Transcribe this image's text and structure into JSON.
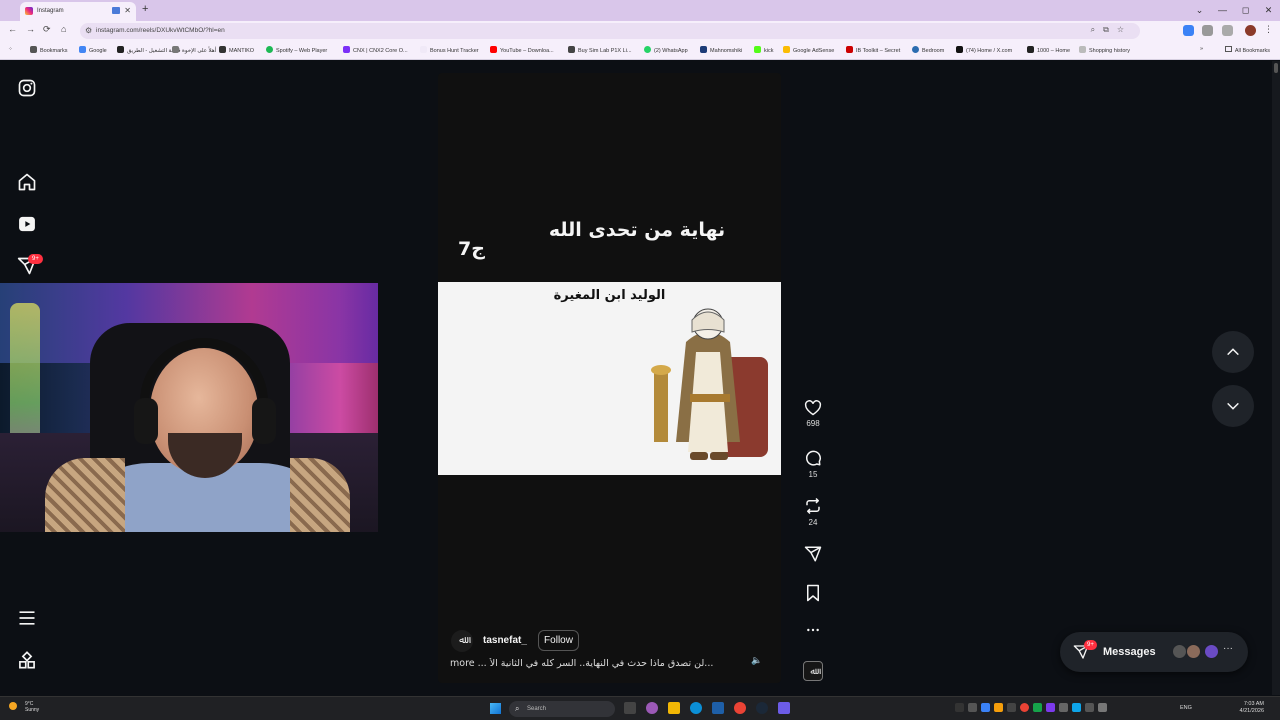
{
  "browser": {
    "tab_title": "Instagram",
    "url": "instagram.com/reels/DXUkvWtCMbO/?hl=en",
    "bookmarks": [
      "Bookmarks",
      "Google",
      "قائمة التشغيل - الطريق",
      "أهلاً على الإخوة",
      "MANTIKO",
      "Spotify – Web Player",
      "CNX | CNX2 Core O...",
      "Bonus Hunt Tracker",
      "YouTube – Downloa...",
      "Buy Sim Lab P1X Li...",
      "(2) WhatsApp",
      "Mahnomshiki",
      "kick",
      "Google AdSense",
      "IB Toolkit – Secret",
      "Bedroom",
      "(74) Home / X.com",
      "1000 – Home",
      "Shopping history"
    ],
    "all_bookmarks_label": "All Bookmarks"
  },
  "sidebar": {
    "notifications_badge": "9+"
  },
  "reel": {
    "title": "نهاية من تحدى الله",
    "part_label": "ج7",
    "panel_title": "الوليد ابن المغيرة",
    "username": "tasnefat_",
    "avatar_letter": "ﷲ",
    "follow_label": "Follow",
    "caption": "لن تصدق ماذا حدث في النهاية.. السر كله في الثانية الأ...",
    "more_label": "more",
    "likes": "698",
    "comments": "15",
    "reposts": "24"
  },
  "messages": {
    "label": "Messages",
    "badge": "9+"
  },
  "taskbar": {
    "weather_temp": "9°C",
    "weather_desc": "Sunny",
    "search_placeholder": "Search",
    "language": "ENG",
    "time": "7:03 AM",
    "date": "4/21/2026"
  }
}
